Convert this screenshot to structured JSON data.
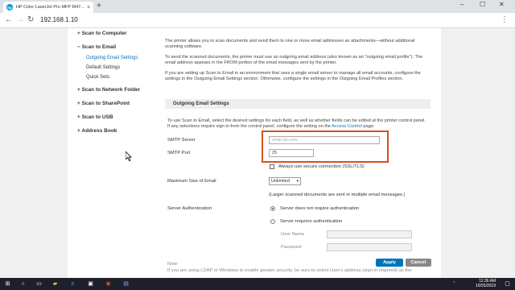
{
  "browser": {
    "tab_title": "HP Color LaserJet Pro MFP M47...",
    "tab_favicon": "hp",
    "url": "192.168.1.10",
    "new_tab": "+",
    "win_min": "–",
    "win_max": "☐",
    "win_close": "✕"
  },
  "sidebar": {
    "scan_to_computer": "+ Scan to Computer",
    "scan_to_email": "− Scan to Email",
    "email_items": [
      "Outgoing Email Settings",
      "Default Settings",
      "Quick Sets"
    ],
    "scan_to_network_folder": "+ Scan to Network Folder",
    "scan_to_sharepoint": "+ Scan to SharePoint",
    "scan_to_usb": "+ Scan to USB",
    "address_book": "+ Address Book"
  },
  "main": {
    "para1": "The printer allows you to scan documents and send them to one or more email addresses as attachments—without additional scanning software.",
    "para2": "To send the scanned documents, the printer must use an outgoing email address (also known as an \"outgoing email profile\"). The email address appears in the FROM portion of the email messages sent by the printer.",
    "para3": "If you are setting up Scan to Email in an environment that uses a single email server to manage all email accounts, configure the settings in the Outgoing Email Settings section. Otherwise, configure the settings in the Outgoing Email Profiles section.",
    "section_title": "Outgoing Email Settings",
    "desc_a": "To use Scan to Email, select the desired settings for each field, as well as whether fields can be edited at the printer control panel. If any selections require sign in from the control panel, configure the setting on the",
    "desc_link": "Access Control",
    "desc_b": "page."
  },
  "form": {
    "smtp_server_label": "SMTP Server",
    "smtp_server_placeholder": "smtp.hp.com",
    "smtp_port_label": "SMTP Port",
    "smtp_port_value": "25",
    "ssl_label": "Always use secure connection (SSL/TLS)",
    "ssl_checked": false,
    "max_size_label": "Maximum Size of Email",
    "max_size_value": "Unlimited",
    "max_size_note": "(Larger scanned documents are sent in multiple email messages.)",
    "auth_label": "Server Authentication",
    "auth_option_none": "Server does not require authentication",
    "auth_option_required": "Server requires authentication",
    "user_name_label": "User Name",
    "password_label": "Password",
    "note_label": "Note:",
    "note_text": "If you are using LDAP or Windows to enable greater security, be sure to select User's address (sign-in required) as the",
    "apply": "Apply",
    "cancel": "Cancel"
  },
  "taskbar": {
    "time": "11:36 AM",
    "date": "10/25/2019"
  }
}
